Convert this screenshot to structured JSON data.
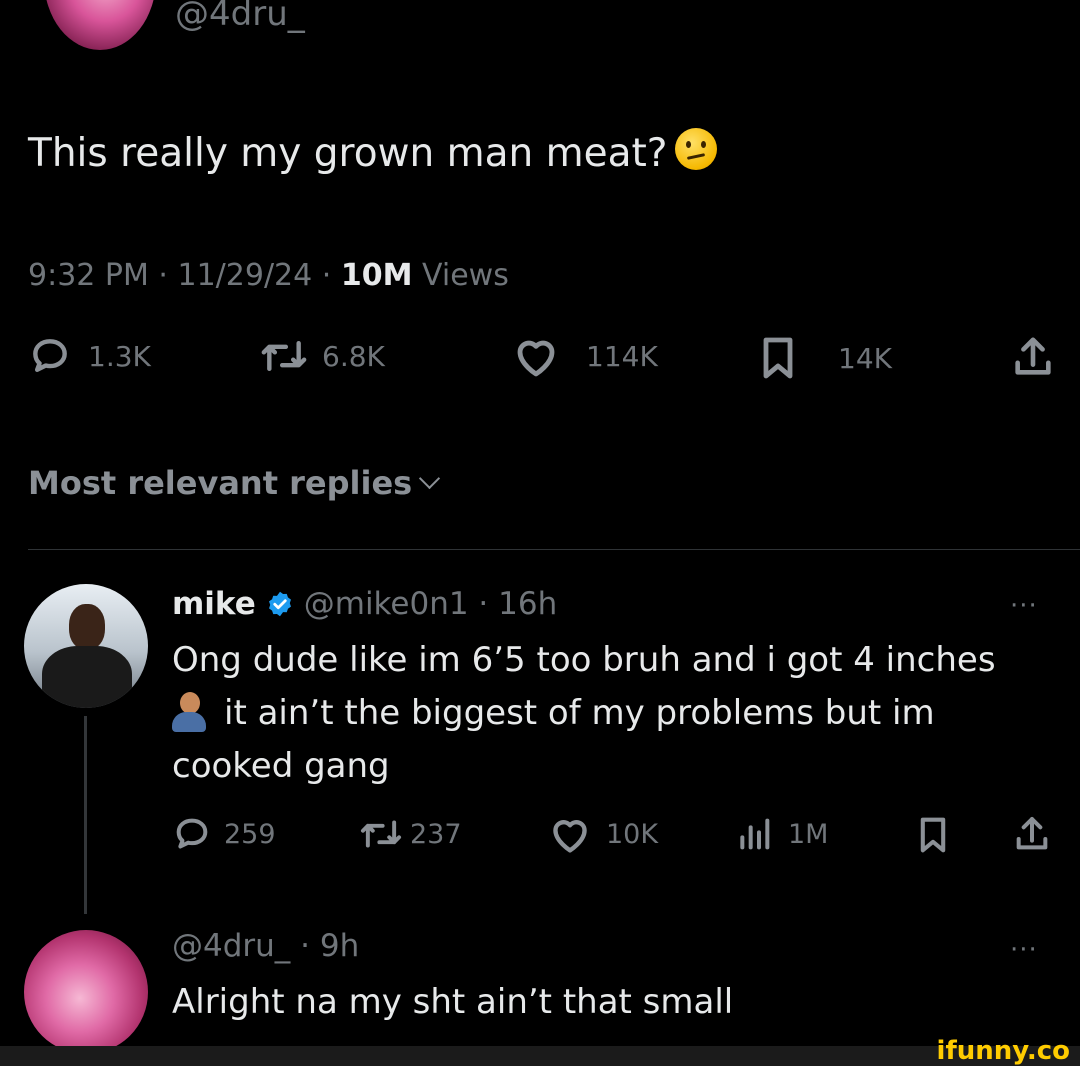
{
  "main_tweet": {
    "handle": "@4dru_",
    "text": "This really my grown man meat?",
    "emoji": "confused-face",
    "time": "9:32 PM · 11/29/24 ·",
    "views_count": "10M",
    "views_label": "Views",
    "stats": {
      "replies": "1.3K",
      "reposts": "6.8K",
      "likes": "114K",
      "bookmarks": "14K"
    }
  },
  "replies_header": "Most relevant replies",
  "replies": [
    {
      "name": "mike",
      "handle_time": "@mike0n1 · 16h",
      "more": "···",
      "text_line1": "Ong dude like im 6’5 too bruh and i got 4 inches",
      "text_line2": "it ain’t the biggest of my problems but im",
      "text_line3": "cooked gang",
      "stats": {
        "replies": "259",
        "reposts": "237",
        "likes": "10K",
        "views": "1M"
      }
    },
    {
      "handle_time": "@4dru_ · 9h",
      "more": "···",
      "text": "Alright na my sht ain’t that small"
    }
  ],
  "watermark": "ifunny.co",
  "colors": {
    "background": "#000000",
    "text": "#e7e9ea",
    "muted": "#71767b",
    "verified": "#1d9bf0"
  }
}
